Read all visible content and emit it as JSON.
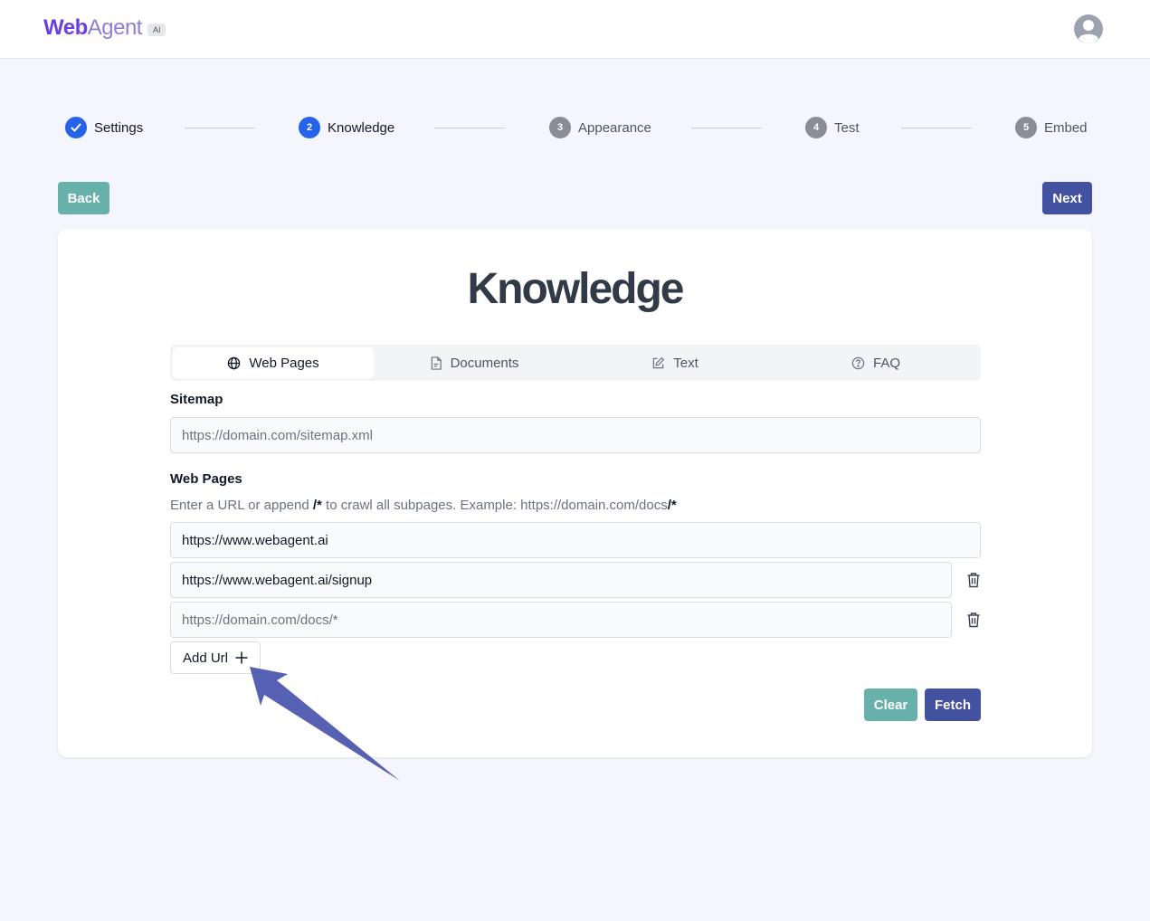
{
  "header": {
    "logo_web": "Web",
    "logo_agent": "Agent",
    "logo_badge": "AI"
  },
  "steps": [
    {
      "number": "1",
      "label": "Settings",
      "state": "done"
    },
    {
      "number": "2",
      "label": "Knowledge",
      "state": "active"
    },
    {
      "number": "3",
      "label": "Appearance",
      "state": "pending"
    },
    {
      "number": "4",
      "label": "Test",
      "state": "pending"
    },
    {
      "number": "5",
      "label": "Embed",
      "state": "pending"
    }
  ],
  "nav": {
    "back_label": "Back",
    "next_label": "Next"
  },
  "card": {
    "title": "Knowledge",
    "tabs": [
      {
        "label": "Web Pages",
        "icon": "globe-icon",
        "active": true
      },
      {
        "label": "Documents",
        "icon": "document-icon",
        "active": false
      },
      {
        "label": "Text",
        "icon": "pencil-icon",
        "active": false
      },
      {
        "label": "FAQ",
        "icon": "question-icon",
        "active": false
      }
    ],
    "sitemap": {
      "label": "Sitemap",
      "placeholder": "https://domain.com/sitemap.xml",
      "value": ""
    },
    "web_pages": {
      "label": "Web Pages",
      "helper_prefix": "Enter a URL or append ",
      "helper_bold1": "/*",
      "helper_middle": " to crawl all subpages. Example: https://domain.com/docs",
      "helper_bold2": "/*",
      "urls": [
        {
          "value": "https://www.webagent.ai",
          "placeholder": "https://domain.com/docs/*"
        },
        {
          "value": "https://www.webagent.ai/signup",
          "placeholder": "https://domain.com/docs/*"
        },
        {
          "value": "",
          "placeholder": "https://domain.com/docs/*"
        }
      ],
      "add_url_label": "Add Url"
    },
    "clear_label": "Clear",
    "fetch_label": "Fetch"
  },
  "colors": {
    "primary": "#4351a1",
    "secondary": "#68b0aa",
    "step_active": "#2563eb",
    "annotation_arrow": "#5661b3"
  }
}
